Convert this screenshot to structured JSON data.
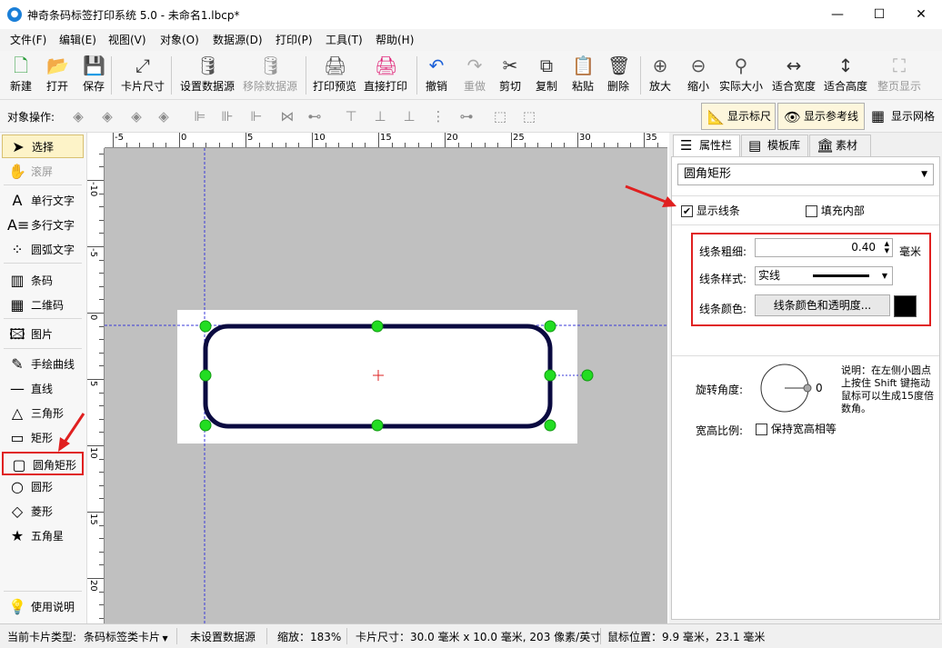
{
  "window": {
    "title": "神奇条码标签打印系统 5.0 - 未命名1.lbcp*",
    "app_icon": "app-logo-icon",
    "minimize": "—",
    "maximize": "☐",
    "close": "✕"
  },
  "menu": [
    "文件(F)",
    "编辑(E)",
    "视图(V)",
    "对象(O)",
    "数据源(D)",
    "打印(P)",
    "工具(T)",
    "帮助(H)"
  ],
  "toolbar": [
    {
      "label": "新建",
      "icon": "new-file-icon",
      "glyph": "🗋",
      "disabled": false
    },
    {
      "label": "打开",
      "icon": "open-icon",
      "glyph": "📂",
      "disabled": false
    },
    {
      "label": "保存",
      "icon": "save-icon",
      "glyph": "💾",
      "disabled": false
    },
    {
      "label": "卡片尺寸",
      "icon": "card-size-icon",
      "glyph": "⤢",
      "disabled": false
    },
    {
      "label": "设置数据源",
      "icon": "database-icon",
      "glyph": "🛢",
      "disabled": false
    },
    {
      "label": "移除数据源",
      "icon": "remove-database-icon",
      "glyph": "🛢",
      "disabled": true
    },
    {
      "label": "打印预览",
      "icon": "print-preview-icon",
      "glyph": "🖨",
      "disabled": false
    },
    {
      "label": "直接打印",
      "icon": "print-icon",
      "glyph": "🖨",
      "disabled": false
    },
    {
      "label": "撤销",
      "icon": "undo-icon",
      "glyph": "↶",
      "disabled": false
    },
    {
      "label": "重做",
      "icon": "redo-icon",
      "glyph": "↷",
      "disabled": true
    },
    {
      "label": "剪切",
      "icon": "cut-icon",
      "glyph": "✂",
      "disabled": false
    },
    {
      "label": "复制",
      "icon": "copy-icon",
      "glyph": "⧉",
      "disabled": false
    },
    {
      "label": "粘贴",
      "icon": "paste-icon",
      "glyph": "📋",
      "disabled": false
    },
    {
      "label": "删除",
      "icon": "delete-icon",
      "glyph": "🗑",
      "disabled": false
    },
    {
      "label": "放大",
      "icon": "zoom-in-icon",
      "glyph": "⊕",
      "disabled": false
    },
    {
      "label": "缩小",
      "icon": "zoom-out-icon",
      "glyph": "⊖",
      "disabled": false
    },
    {
      "label": "实际大小",
      "icon": "actual-size-icon",
      "glyph": "⚲",
      "disabled": false
    },
    {
      "label": "适合宽度",
      "icon": "fit-width-icon",
      "glyph": "↔",
      "disabled": false
    },
    {
      "label": "适合高度",
      "icon": "fit-height-icon",
      "glyph": "↕",
      "disabled": false
    },
    {
      "label": "整页显示",
      "icon": "fit-page-icon",
      "glyph": "⛶",
      "disabled": true
    }
  ],
  "objbar": {
    "label": "对象操作:",
    "show_ruler": "显示标尺",
    "show_guides": "显示参考线",
    "show_grid": "显示网格"
  },
  "tools": [
    {
      "label": "选择",
      "icon": "pointer-icon",
      "glyph": "➤",
      "selected": true,
      "disabled": false
    },
    {
      "label": "滚屏",
      "icon": "hand-icon",
      "glyph": "✋",
      "selected": false,
      "disabled": true
    },
    {
      "label": "单行文字",
      "icon": "single-text-icon",
      "glyph": "A",
      "selected": false,
      "disabled": false
    },
    {
      "label": "多行文字",
      "icon": "multi-text-icon",
      "glyph": "A≡",
      "selected": false,
      "disabled": false
    },
    {
      "label": "圆弧文字",
      "icon": "arc-text-icon",
      "glyph": "⁘",
      "selected": false,
      "disabled": false
    },
    {
      "label": "条码",
      "icon": "barcode-icon",
      "glyph": "▥",
      "selected": false,
      "disabled": false
    },
    {
      "label": "二维码",
      "icon": "qrcode-icon",
      "glyph": "▦",
      "selected": false,
      "disabled": false
    },
    {
      "label": "图片",
      "icon": "image-icon",
      "glyph": "🖾",
      "selected": false,
      "disabled": false
    },
    {
      "label": "手绘曲线",
      "icon": "pen-icon",
      "glyph": "✎",
      "selected": false,
      "disabled": false
    },
    {
      "label": "直线",
      "icon": "line-icon",
      "glyph": "—",
      "selected": false,
      "disabled": false
    },
    {
      "label": "三角形",
      "icon": "triangle-icon",
      "glyph": "△",
      "selected": false,
      "disabled": false
    },
    {
      "label": "矩形",
      "icon": "rectangle-icon",
      "glyph": "▭",
      "selected": false,
      "disabled": false
    },
    {
      "label": "圆角矩形",
      "icon": "rounded-rectangle-icon",
      "glyph": "▢",
      "selected": false,
      "disabled": false,
      "highlighted": true
    },
    {
      "label": "圆形",
      "icon": "circle-icon",
      "glyph": "○",
      "selected": false,
      "disabled": false
    },
    {
      "label": "菱形",
      "icon": "diamond-icon",
      "glyph": "◇",
      "selected": false,
      "disabled": false
    },
    {
      "label": "五角星",
      "icon": "star-icon",
      "glyph": "★",
      "selected": false,
      "disabled": false
    },
    {
      "label": "使用说明",
      "icon": "lightbulb-icon",
      "glyph": "💡",
      "selected": false,
      "disabled": false
    }
  ],
  "ruler": {
    "top_labels": [
      "-5",
      "0",
      "5",
      "10",
      "15",
      "20",
      "25",
      "30",
      "35"
    ],
    "left_labels": [
      "-10",
      "-5",
      "0",
      "5",
      "10",
      "15",
      "20"
    ]
  },
  "tabs": [
    {
      "label": "属性栏",
      "icon": "list-icon",
      "active": true
    },
    {
      "label": "模板库",
      "icon": "template-icon",
      "active": false
    },
    {
      "label": "素材库",
      "icon": "library-icon",
      "active": false
    }
  ],
  "props": {
    "object_type": "圆角矩形",
    "show_line": "显示线条",
    "show_line_checked": true,
    "fill_inside": "填充内部",
    "fill_inside_checked": false,
    "line_width_label": "线条粗细:",
    "line_width_value": "0.40",
    "line_width_unit": "毫米",
    "line_style_label": "线条样式:",
    "line_style_value": "实线",
    "line_color_label": "线条颜色:",
    "line_color_button": "线条颜色和透明度...",
    "line_color": "#000000",
    "rotation_label": "旋转角度:",
    "rotation_value": "0",
    "rotation_hint": "说明：在左侧小圆点上按住 Shift 键拖动鼠标可以生成15度倍数角。",
    "aspect_label": "宽高比例:",
    "keep_aspect": "保持宽高相等",
    "keep_aspect_checked": false
  },
  "status": {
    "card_type_label": "当前卡片类型:",
    "card_type_value": "条码标签类卡片",
    "datasource": "未设置数据源",
    "zoom": "缩放：183%",
    "card_size": "卡片尺寸：30.0 毫米 x 10.0 毫米, 203 像素/英寸",
    "mouse_pos": "鼠标位置：9.9 毫米，23.1 毫米"
  },
  "colors": {
    "highlight_red": "#e02020",
    "handle_green": "#22dd22",
    "guide_blue": "#3a3ad8",
    "shape_stroke": "#0a0a40"
  }
}
